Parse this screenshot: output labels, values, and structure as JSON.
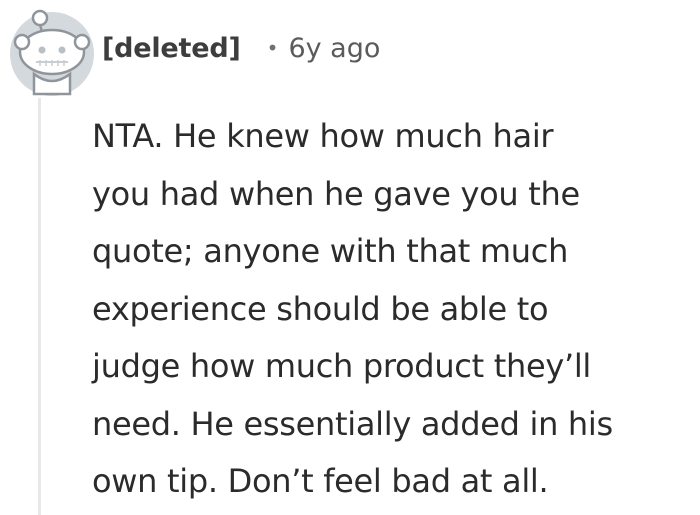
{
  "comment": {
    "author": "[deleted]",
    "separator": "•",
    "age": "6y ago",
    "body_lines": [
      "NTA. He knew how much hair",
      "you had when he gave you the",
      "quote; anyone with that much",
      "experience should be able to",
      "judge how much product they’ll",
      "need. He essentially added in his",
      "own tip. Don’t feel bad at all."
    ],
    "avatar_icon": "reddit-snoo-deleted-icon",
    "colors": {
      "text": "#2b2b2b",
      "meta": "#5b5b5b",
      "thread_line": "#e8e8e8",
      "avatar_bg": "#d4d9de"
    }
  }
}
